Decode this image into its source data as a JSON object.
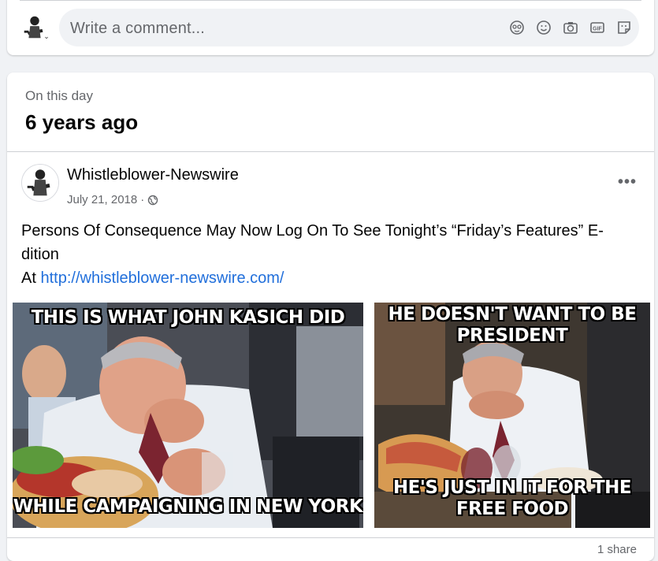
{
  "comment": {
    "placeholder": "Write a comment...",
    "icons": [
      "avatar-sticker-icon",
      "emoji-icon",
      "camera-icon",
      "gif-icon",
      "sticker-icon"
    ]
  },
  "memory": {
    "label": "On this day",
    "years_ago": "6 years ago"
  },
  "post": {
    "author": "Whistleblower-Newswire",
    "date": "July 21, 2018",
    "separator": "·",
    "audience_icon": "globe-icon",
    "more": "•••",
    "text_line1": "Persons Of Consequence May Now Log On To See Tonight’s “Friday’s Features” E-dition",
    "text_at": "At",
    "link": "http://whistleblower-newswire.com/"
  },
  "photos": [
    {
      "top_text": "THIS IS WHAT JOHN KASICH DID",
      "bottom_text": "WHILE CAMPAIGNING IN NEW YORK"
    },
    {
      "top_text": "HE DOESN'T WANT TO BE PRESIDENT",
      "bottom_text": "HE'S JUST IN IT FOR THE FREE FOOD"
    }
  ],
  "footer": {
    "shares": "1 share"
  }
}
